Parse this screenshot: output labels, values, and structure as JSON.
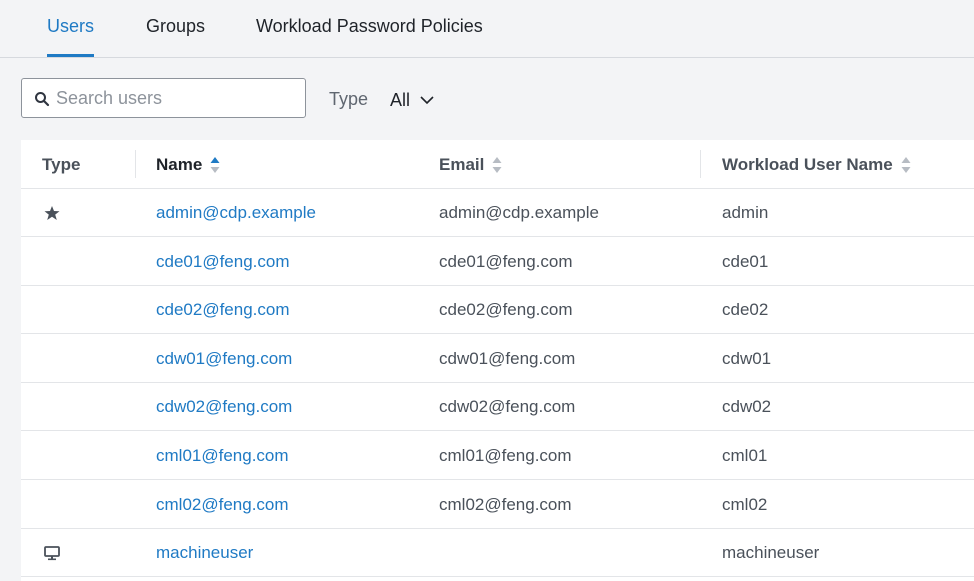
{
  "tabs": [
    {
      "label": "Users",
      "active": true
    },
    {
      "label": "Groups",
      "active": false
    },
    {
      "label": "Workload Password Policies",
      "active": false
    }
  ],
  "search": {
    "placeholder": "Search users",
    "value": ""
  },
  "filter": {
    "label": "Type",
    "selected": "All"
  },
  "table": {
    "columns": [
      "Type",
      "Name",
      "Email",
      "Workload User Name"
    ],
    "sorted_column": "Name",
    "rows": [
      {
        "type_icon": "star-icon",
        "name": "admin@cdp.example",
        "email": "admin@cdp.example",
        "workload": "admin"
      },
      {
        "type_icon": "",
        "name": "cde01@feng.com",
        "email": "cde01@feng.com",
        "workload": "cde01"
      },
      {
        "type_icon": "",
        "name": "cde02@feng.com",
        "email": "cde02@feng.com",
        "workload": "cde02"
      },
      {
        "type_icon": "",
        "name": "cdw01@feng.com",
        "email": "cdw01@feng.com",
        "workload": "cdw01"
      },
      {
        "type_icon": "",
        "name": "cdw02@feng.com",
        "email": "cdw02@feng.com",
        "workload": "cdw02"
      },
      {
        "type_icon": "",
        "name": "cml01@feng.com",
        "email": "cml01@feng.com",
        "workload": "cml01"
      },
      {
        "type_icon": "",
        "name": "cml02@feng.com",
        "email": "cml02@feng.com",
        "workload": "cml02"
      },
      {
        "type_icon": "monitor-icon",
        "name": "machineuser",
        "email": "",
        "workload": "machineuser"
      }
    ]
  },
  "colors": {
    "accent": "#1f7ac4",
    "text": "#2f3540",
    "muted": "#8d939b",
    "background": "#f3f4f6"
  }
}
